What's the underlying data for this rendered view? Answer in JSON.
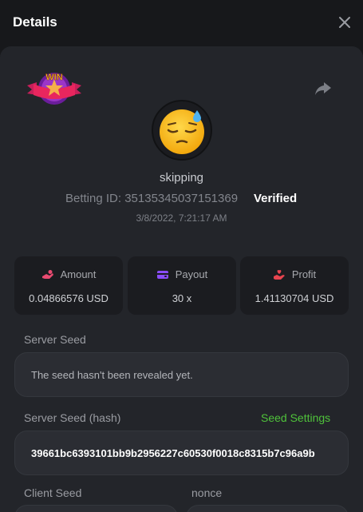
{
  "header": {
    "title": "Details"
  },
  "icons": {
    "close": "close-icon",
    "share": "share-icon",
    "badge": "win-badge-icon",
    "avatar": "sleepy-emoji-icon",
    "amount": "hand-coin-icon",
    "payout": "wallet-icon",
    "profit": "hand-heart-icon"
  },
  "badge": {
    "text": "WIN"
  },
  "player": {
    "username": "skipping",
    "betting_id_label": "Betting ID:",
    "betting_id": "35135345037151369",
    "verified": "Verified",
    "timestamp": "3/8/2022, 7:21:17 AM"
  },
  "stats": [
    {
      "label": "Amount",
      "value": "0.04866576 USD",
      "icon": "amount",
      "color": "#e94b71"
    },
    {
      "label": "Payout",
      "value": "30 x",
      "icon": "payout",
      "color": "#8a4dfc"
    },
    {
      "label": "Profit",
      "value": "1.41130704 USD",
      "icon": "profit",
      "color": "#e8454f"
    }
  ],
  "server_seed": {
    "label": "Server Seed",
    "value": "The seed hasn't been revealed yet."
  },
  "server_seed_hash": {
    "label": "Server Seed (hash)",
    "link": "Seed Settings",
    "value": "39661bc6393101bb9b2956227c60530f0018c8315b7c96a9b"
  },
  "client_seed": {
    "label": "Client Seed"
  },
  "nonce": {
    "label": "nonce"
  },
  "colors": {
    "accent_green": "#4fc23b",
    "panel": "#23252a",
    "background": "#17181b"
  }
}
